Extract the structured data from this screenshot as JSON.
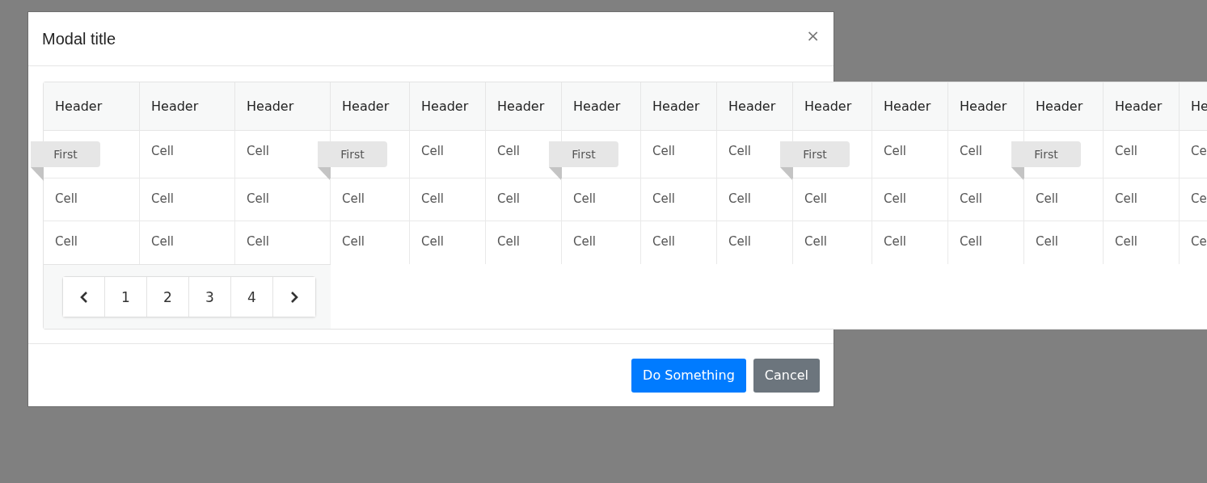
{
  "modal": {
    "title": "Modal title",
    "close": "×"
  },
  "table": {
    "columns": [
      "Header",
      "Header",
      "Header",
      "Header",
      "Header",
      "Header",
      "Header",
      "Header",
      "Header",
      "Header",
      "Header",
      "Header",
      "Header",
      "Header",
      "He"
    ],
    "rows": [
      [
        {
          "kind": "ribbon",
          "text": "First"
        },
        {
          "kind": "cell",
          "text": "Cell"
        },
        {
          "kind": "cell",
          "text": "Cell"
        },
        {
          "kind": "ribbon",
          "text": "First"
        },
        {
          "kind": "cell",
          "text": "Cell"
        },
        {
          "kind": "cell",
          "text": "Cell"
        },
        {
          "kind": "ribbon",
          "text": "First"
        },
        {
          "kind": "cell",
          "text": "Cell"
        },
        {
          "kind": "cell",
          "text": "Cell"
        },
        {
          "kind": "ribbon",
          "text": "First"
        },
        {
          "kind": "cell",
          "text": "Cell"
        },
        {
          "kind": "cell",
          "text": "Cell"
        },
        {
          "kind": "ribbon",
          "text": "First"
        },
        {
          "kind": "cell",
          "text": "Cell"
        },
        {
          "kind": "cell",
          "text": "Ce"
        }
      ],
      [
        {
          "kind": "cell",
          "text": "Cell"
        },
        {
          "kind": "cell",
          "text": "Cell"
        },
        {
          "kind": "cell",
          "text": "Cell"
        },
        {
          "kind": "cell",
          "text": "Cell"
        },
        {
          "kind": "cell",
          "text": "Cell"
        },
        {
          "kind": "cell",
          "text": "Cell"
        },
        {
          "kind": "cell",
          "text": "Cell"
        },
        {
          "kind": "cell",
          "text": "Cell"
        },
        {
          "kind": "cell",
          "text": "Cell"
        },
        {
          "kind": "cell",
          "text": "Cell"
        },
        {
          "kind": "cell",
          "text": "Cell"
        },
        {
          "kind": "cell",
          "text": "Cell"
        },
        {
          "kind": "cell",
          "text": "Cell"
        },
        {
          "kind": "cell",
          "text": "Cell"
        },
        {
          "kind": "cell",
          "text": "Ce"
        }
      ],
      [
        {
          "kind": "cell",
          "text": "Cell"
        },
        {
          "kind": "cell",
          "text": "Cell"
        },
        {
          "kind": "cell",
          "text": "Cell"
        },
        {
          "kind": "cell",
          "text": "Cell"
        },
        {
          "kind": "cell",
          "text": "Cell"
        },
        {
          "kind": "cell",
          "text": "Cell"
        },
        {
          "kind": "cell",
          "text": "Cell"
        },
        {
          "kind": "cell",
          "text": "Cell"
        },
        {
          "kind": "cell",
          "text": "Cell"
        },
        {
          "kind": "cell",
          "text": "Cell"
        },
        {
          "kind": "cell",
          "text": "Cell"
        },
        {
          "kind": "cell",
          "text": "Cell"
        },
        {
          "kind": "cell",
          "text": "Cell"
        },
        {
          "kind": "cell",
          "text": "Cell"
        },
        {
          "kind": "cell",
          "text": "Ce"
        }
      ]
    ]
  },
  "pagination": {
    "pages": [
      "1",
      "2",
      "3",
      "4"
    ]
  },
  "buttons": [
    {
      "kind": "primary",
      "label": "Do Something"
    },
    {
      "kind": "secondary",
      "label": "Cancel"
    }
  ]
}
